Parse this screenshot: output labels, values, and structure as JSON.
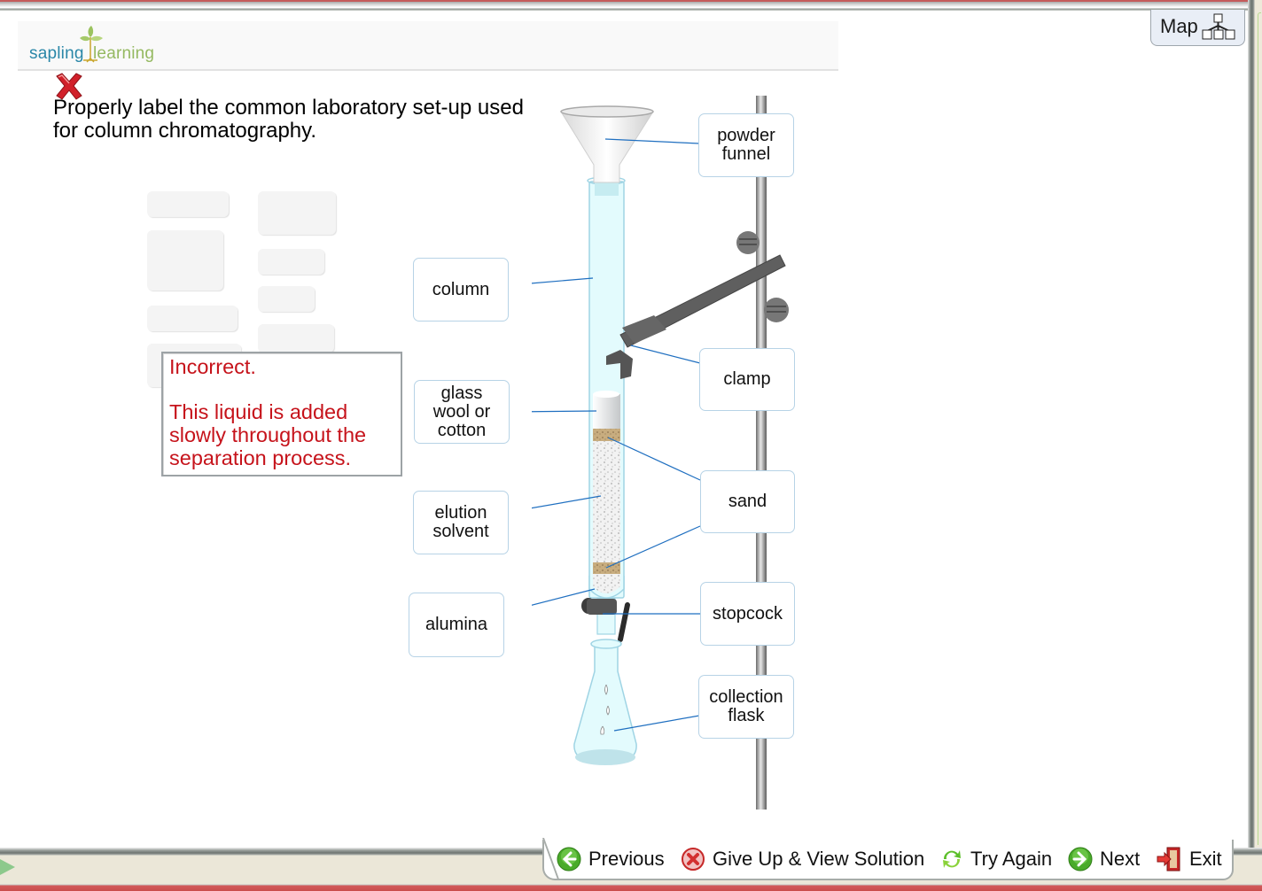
{
  "header": {
    "logo_word1": "sapling",
    "logo_word2": "learning"
  },
  "map_button": {
    "label": "Map",
    "icon": "sitemap-icon"
  },
  "question": {
    "status_icon": "incorrect-x-icon",
    "prompt": "Properly label the common laboratory set-up used for column chromatography."
  },
  "feedback": {
    "title": "Incorrect.",
    "message": "This liquid is added slowly throughout the separation process.",
    "color": "#c6131b"
  },
  "labels": [
    {
      "id": "powder-funnel",
      "text": "powder\nfunnel"
    },
    {
      "id": "column",
      "text": "column"
    },
    {
      "id": "clamp",
      "text": "clamp"
    },
    {
      "id": "glass-wool",
      "text": "glass\nwool or\ncotton"
    },
    {
      "id": "sand",
      "text": "sand"
    },
    {
      "id": "elution-solvent",
      "text": "elution\nsolvent"
    },
    {
      "id": "alumina",
      "text": "alumina"
    },
    {
      "id": "stopcock",
      "text": "stopcock"
    },
    {
      "id": "collection-flask",
      "text": "collection\nflask"
    }
  ],
  "navigation": {
    "previous": "Previous",
    "give_up": "Give Up & View Solution",
    "try_again": "Try Again",
    "next": "Next",
    "exit": "Exit"
  },
  "colors": {
    "leader_line": "#1f6fc0",
    "label_border": "#b7d3e6",
    "brand_blue": "#2a87a8",
    "brand_green": "#95b961"
  }
}
